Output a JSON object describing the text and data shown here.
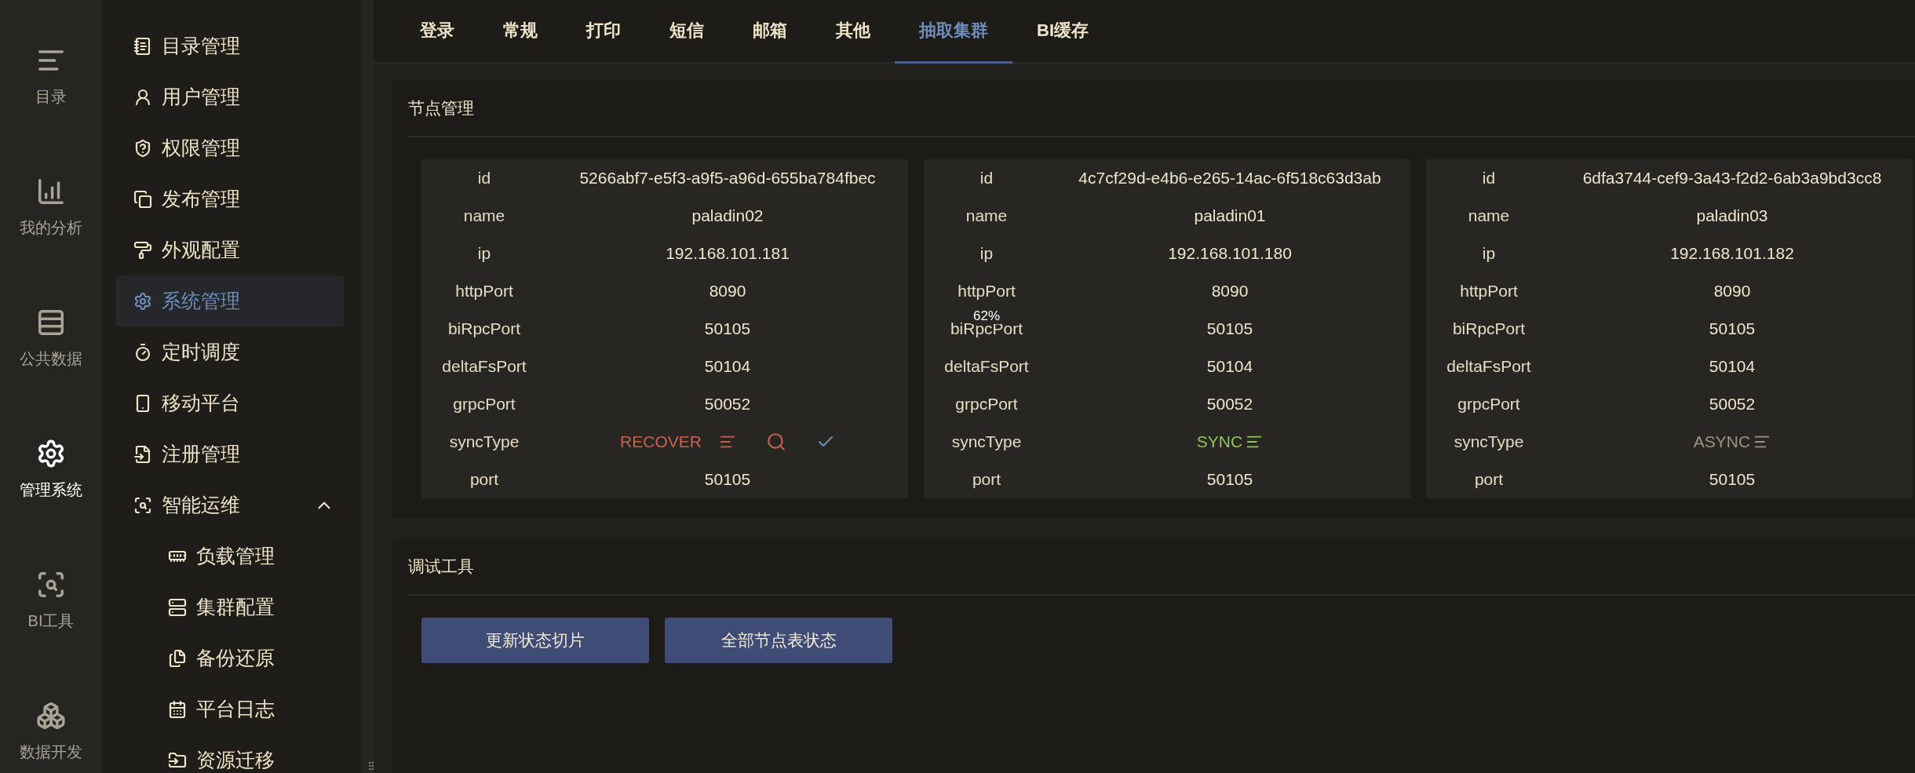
{
  "rail": {
    "items": [
      {
        "label": "目录",
        "selected": false
      },
      {
        "label": "我的分析",
        "selected": false
      },
      {
        "label": "公共数据",
        "selected": false
      },
      {
        "label": "管理系统",
        "selected": true
      },
      {
        "label": "BI工具",
        "selected": false
      },
      {
        "label": "数据开发",
        "selected": false
      }
    ]
  },
  "sidebar": {
    "items": [
      {
        "label": "目录管理",
        "selected": false
      },
      {
        "label": "用户管理",
        "selected": false
      },
      {
        "label": "权限管理",
        "selected": false
      },
      {
        "label": "发布管理",
        "selected": false
      },
      {
        "label": "外观配置",
        "selected": false
      },
      {
        "label": "系统管理",
        "selected": true
      },
      {
        "label": "定时调度",
        "selected": false
      },
      {
        "label": "移动平台",
        "selected": false
      },
      {
        "label": "注册管理",
        "selected": false
      },
      {
        "label": "智能运维",
        "selected": false,
        "expanded": true,
        "children": [
          {
            "label": "负载管理",
            "selected": false
          },
          {
            "label": "集群配置",
            "selected": false
          },
          {
            "label": "备份还原",
            "selected": false
          },
          {
            "label": "平台日志",
            "selected": false
          },
          {
            "label": "资源迁移",
            "selected": false
          }
        ]
      }
    ]
  },
  "tabs": [
    {
      "label": "登录",
      "selected": false
    },
    {
      "label": "常规",
      "selected": false
    },
    {
      "label": "打印",
      "selected": false
    },
    {
      "label": "短信",
      "selected": false
    },
    {
      "label": "邮箱",
      "selected": false
    },
    {
      "label": "其他",
      "selected": false
    },
    {
      "label": "抽取集群",
      "selected": true
    },
    {
      "label": "BI缓存",
      "selected": false
    }
  ],
  "node_panel": {
    "title": "节点管理",
    "nodes": [
      {
        "rows": [
          {
            "kind": "text",
            "label": "id",
            "value": "5266abf7-e5f3-a9f5-a96d-655ba784fbec"
          },
          {
            "kind": "text",
            "label": "name",
            "value": "paladin02"
          },
          {
            "kind": "text",
            "label": "ip",
            "value": "192.168.101.181"
          },
          {
            "kind": "text",
            "label": "httpPort",
            "value": "8090"
          },
          {
            "kind": "text",
            "label": "biRpcPort",
            "value": "50105"
          },
          {
            "kind": "text",
            "label": "deltaFsPort",
            "value": "50104"
          },
          {
            "kind": "text",
            "label": "grpcPort",
            "value": "50052"
          },
          {
            "kind": "sync",
            "label": "syncType",
            "value": "RECOVER",
            "color": "#c9604c",
            "actions": true
          },
          {
            "kind": "text",
            "label": "port",
            "value": "50105"
          }
        ]
      },
      {
        "rows": [
          {
            "kind": "text",
            "label": "id",
            "value": "4c7cf29d-e4b6-e265-14ac-6f518c63d3ab"
          },
          {
            "kind": "text",
            "label": "name",
            "value": "paladin01"
          },
          {
            "kind": "text",
            "label": "ip",
            "value": "192.168.101.180"
          },
          {
            "kind": "text",
            "label": "httpPort",
            "value": "8090"
          },
          {
            "kind": "text",
            "label": "biRpcPort",
            "value": "50105",
            "overlay": "62%"
          },
          {
            "kind": "text",
            "label": "deltaFsPort",
            "value": "50104"
          },
          {
            "kind": "text",
            "label": "grpcPort",
            "value": "50052"
          },
          {
            "kind": "sync",
            "label": "syncType",
            "value": "SYNC",
            "color": "#8fc45a",
            "actions": false
          },
          {
            "kind": "text",
            "label": "port",
            "value": "50105"
          }
        ]
      },
      {
        "rows": [
          {
            "kind": "text",
            "label": "id",
            "value": "6dfa3744-cef9-3a43-f2d2-6ab3a9bd3cc8"
          },
          {
            "kind": "text",
            "label": "name",
            "value": "paladin03"
          },
          {
            "kind": "text",
            "label": "ip",
            "value": "192.168.101.182"
          },
          {
            "kind": "text",
            "label": "httpPort",
            "value": "8090"
          },
          {
            "kind": "text",
            "label": "biRpcPort",
            "value": "50105"
          },
          {
            "kind": "text",
            "label": "deltaFsPort",
            "value": "50104"
          },
          {
            "kind": "text",
            "label": "grpcPort",
            "value": "50052"
          },
          {
            "kind": "sync",
            "label": "syncType",
            "value": "ASYNC",
            "color": "#9e9481",
            "actions": false
          },
          {
            "kind": "text",
            "label": "port",
            "value": "50105"
          }
        ]
      }
    ]
  },
  "debug_panel": {
    "title": "调试工具",
    "buttons": [
      "更新状态切片",
      "全部节点表状态"
    ]
  }
}
